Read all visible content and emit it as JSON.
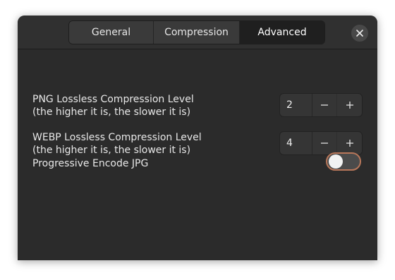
{
  "tabs": [
    {
      "label": "General",
      "active": false
    },
    {
      "label": "Compression",
      "active": false
    },
    {
      "label": "Advanced",
      "active": true
    }
  ],
  "close_icon": "close-icon",
  "settings": {
    "png": {
      "label": "PNG Lossless Compression Level",
      "hint": "(the higher it is, the slower it is)",
      "value": "2"
    },
    "webp": {
      "label": "WEBP Lossless Compression Level",
      "hint": "(the higher it is, the slower it is)",
      "value": "4"
    },
    "progressive": {
      "label": "Progressive Encode JPG",
      "enabled": false
    }
  },
  "colors": {
    "window_bg": "#2b2b2b",
    "headerbar_bg": "#303030",
    "active_tab_bg": "#1f1f1f",
    "focus_ring": "#b8775a"
  }
}
